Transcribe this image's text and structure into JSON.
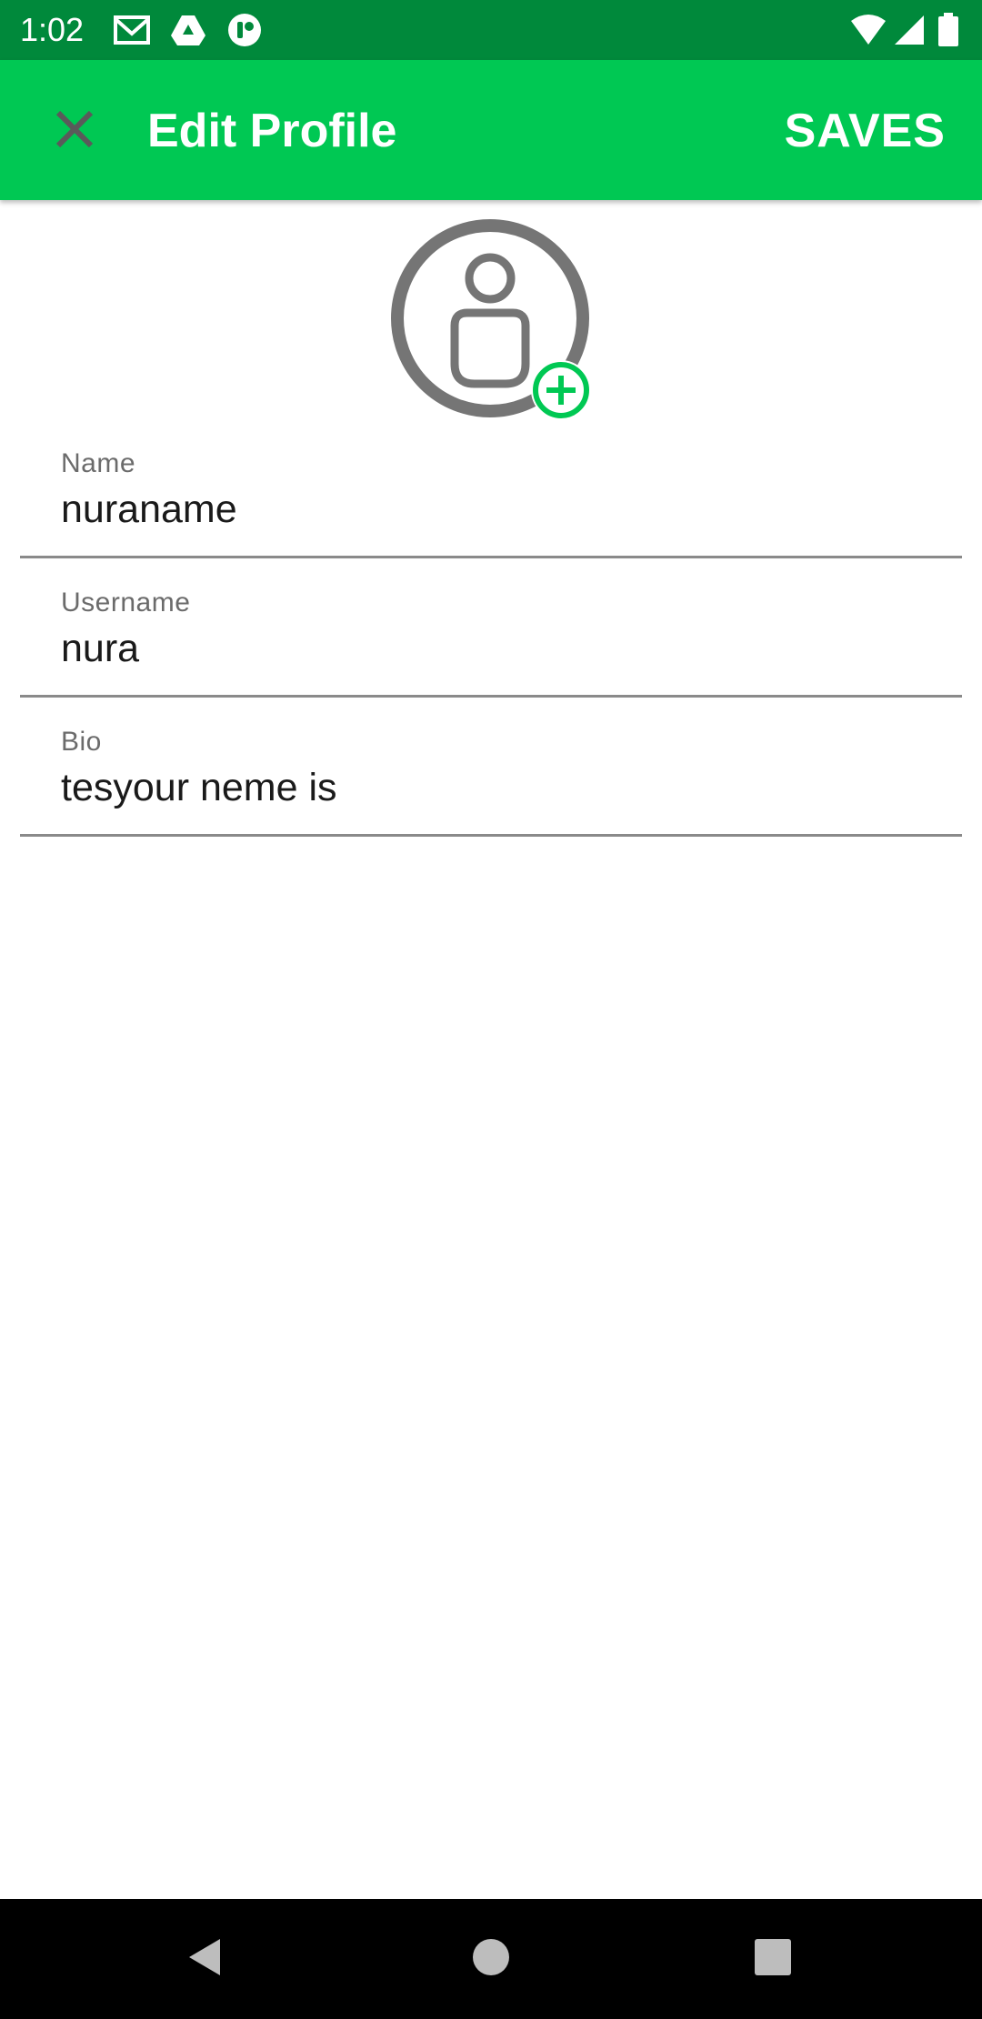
{
  "status_bar": {
    "time": "1:02",
    "left_icons": [
      "gmail-icon",
      "drive-icon",
      "app-notification-icon"
    ],
    "right_icons": [
      "wifi-icon",
      "signal-icon",
      "battery-icon"
    ],
    "background_color": "#00893b"
  },
  "app_bar": {
    "title": "Edit Profile",
    "close_icon": "close-icon",
    "save_label": "SAVES",
    "background_color": "#00c853"
  },
  "avatar": {
    "icon": "user-placeholder-icon",
    "badge_icon": "add-circle-icon",
    "accent_color": "#00c853"
  },
  "form": {
    "fields": [
      {
        "label": "Name",
        "value": "nuraname"
      },
      {
        "label": "Username",
        "value": "nura"
      },
      {
        "label": "Bio",
        "value": "tesyour neme is"
      }
    ]
  },
  "nav_bar": {
    "buttons": [
      "back-icon",
      "home-icon",
      "recents-icon"
    ]
  }
}
